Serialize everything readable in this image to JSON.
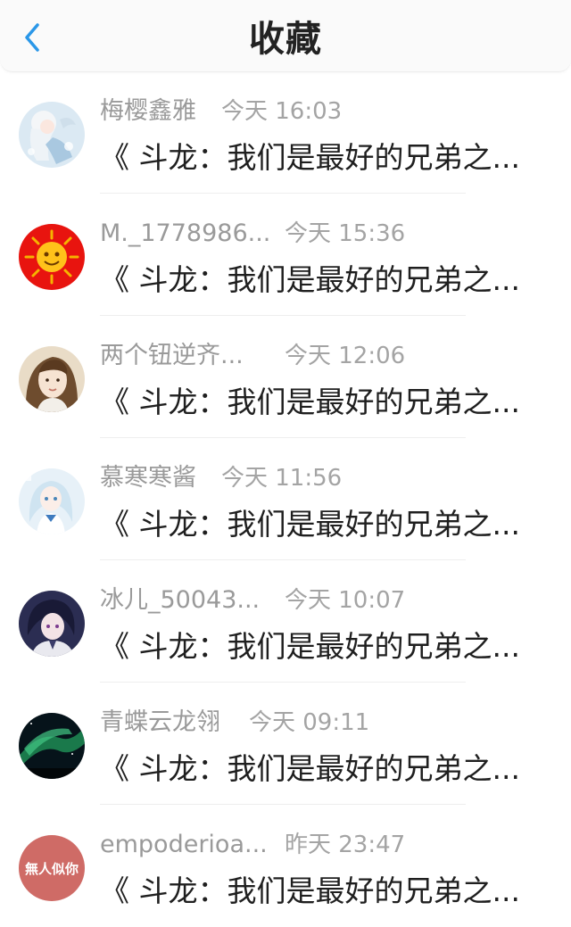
{
  "header": {
    "title": "收藏",
    "back_icon": "chevron-left-icon",
    "accent_color": "#2a97e8"
  },
  "items": [
    {
      "name": "梅樱鑫雅",
      "time": "今天 16:03",
      "title": "《 斗龙：我们是最好的兄弟之...",
      "avatar": "anime-girl-white-hair-avatar"
    },
    {
      "name": "M._1778986...",
      "time": "今天 15:36",
      "title": "《 斗龙：我们是最好的兄弟之...",
      "avatar": "red-sun-avatar"
    },
    {
      "name": "两个钮逆齐...",
      "time": "今天 12:06",
      "title": "《 斗龙：我们是最好的兄弟之...",
      "avatar": "girl-photo-avatar"
    },
    {
      "name": "慕寒寒酱",
      "time": "今天 11:56",
      "title": "《 斗龙：我们是最好的兄弟之...",
      "avatar": "anime-girl-blue-avatar"
    },
    {
      "name": "冰儿_50043...",
      "time": "今天 10:07",
      "title": "《 斗龙：我们是最好的兄弟之...",
      "avatar": "anime-boy-dark-avatar"
    },
    {
      "name": "青蝶云龙翎",
      "time": "今天 09:11",
      "title": "《 斗龙：我们是最好的兄弟之...",
      "avatar": "aurora-avatar"
    },
    {
      "name": "empoderioa...",
      "time": "昨天 23:47",
      "title": "《 斗龙：我们是最好的兄弟之...",
      "avatar": "calligraphy-avatar",
      "avatar_text": "無人似你"
    }
  ]
}
